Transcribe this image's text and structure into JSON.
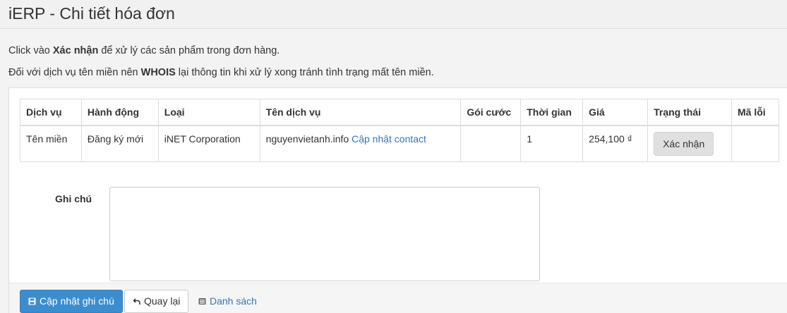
{
  "header": {
    "title": "iERP - Chi tiết hóa đơn"
  },
  "intro": {
    "line1_prefix": "Click vào ",
    "line1_bold": "Xác nhận",
    "line1_suffix": " để xử lý các sản phẩm trong đơn hàng.",
    "line2_prefix": "Đối với dịch vụ tên miền nên ",
    "line2_bold": "WHOIS",
    "line2_suffix": " lại thông tin khi xử lý xong tránh tình trạng mất tên miền."
  },
  "table": {
    "columns": [
      "Dịch vụ",
      "Hành động",
      "Loại",
      "Tên dịch vụ",
      "Gói cước",
      "Thời gian",
      "Giá",
      "Trạng thái",
      "Mã lỗi"
    ],
    "rows": [
      {
        "service": "Tên miền",
        "action": "Đăng ký mới",
        "type": "iNET Corporation",
        "service_name": "nguyenvietanh.info",
        "service_link": "Cập nhật contact",
        "plan": "",
        "duration": "1",
        "price": "254,100 ₫",
        "status_button": "Xác nhận",
        "error_code": ""
      }
    ]
  },
  "note": {
    "label": "Ghi chú",
    "value": ""
  },
  "actions": {
    "update_note": "Cập nhật ghi chú",
    "back": "Quay lại",
    "list": "Danh sách"
  },
  "colors": {
    "primary": "#3c8dcd",
    "link": "#3a75b0"
  }
}
